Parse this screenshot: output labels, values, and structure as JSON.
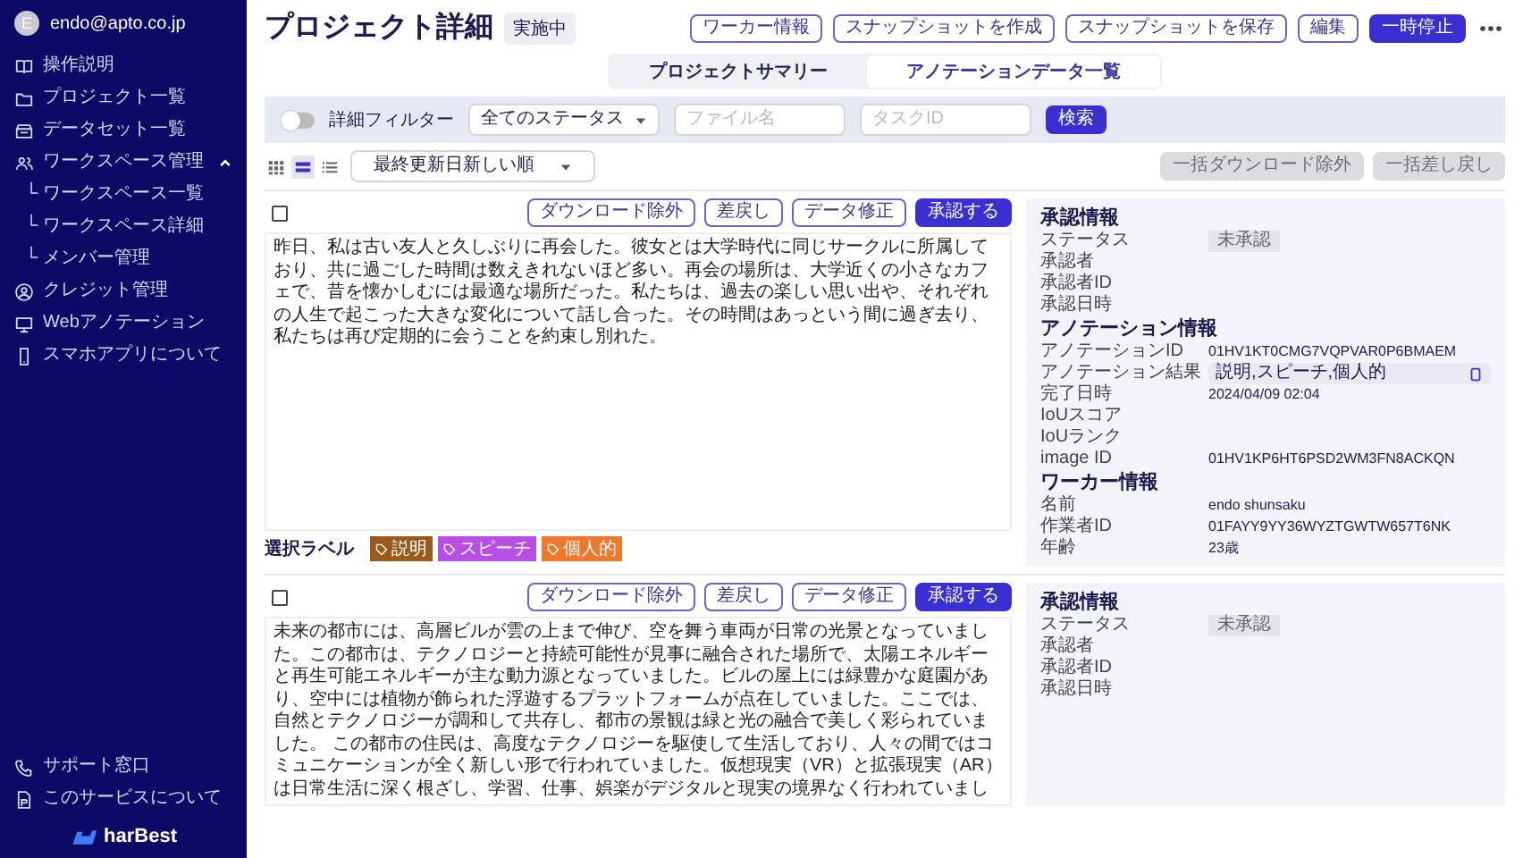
{
  "sidebar": {
    "user": {
      "initial": "E",
      "email": "endo@apto.co.jp"
    },
    "items": [
      {
        "label": "操作説明"
      },
      {
        "label": "プロジェクト一覧"
      },
      {
        "label": "データセット一覧"
      },
      {
        "label": "ワークスペース管理",
        "expanded": true,
        "children": [
          {
            "label": "└ ワークスペース一覧"
          },
          {
            "label": "└ ワークスペース詳細"
          },
          {
            "label": "└ メンバー管理"
          }
        ]
      },
      {
        "label": "クレジット管理"
      },
      {
        "label": "Webアノテーション"
      },
      {
        "label": "スマホアプリについて"
      }
    ],
    "footer_items": [
      {
        "label": "サポート窓口"
      },
      {
        "label": "このサービスについて"
      }
    ],
    "logo": "harBest"
  },
  "header": {
    "title": "プロジェクト詳細",
    "status_badge": "実施中",
    "buttons": [
      {
        "label": "ワーカー情報",
        "primary": false
      },
      {
        "label": "スナップショットを作成",
        "primary": false
      },
      {
        "label": "スナップショットを保存",
        "primary": false
      },
      {
        "label": "編集",
        "primary": false
      },
      {
        "label": "一時停止",
        "primary": true
      }
    ]
  },
  "tabs": [
    {
      "label": "プロジェクトサマリー",
      "selected": false
    },
    {
      "label": "アノテーションデータ一覧",
      "selected": true
    }
  ],
  "filter": {
    "toggle_label": "詳細フィルター",
    "on": false,
    "status_select": "全てのステータス",
    "file_field": {
      "placeholder": "ファイル名"
    },
    "task_field": {
      "placeholder": "タスクID"
    },
    "search_button": "検索"
  },
  "toolbar": {
    "views": [
      {
        "selected": false
      },
      {
        "selected": true
      },
      {
        "selected": false
      }
    ],
    "sort_select": "最終更新日新しい順",
    "bulk_buttons": [
      {
        "label": "一括ダウンロード除外",
        "disabled": true
      },
      {
        "label": "一括差し戻し",
        "disabled": true
      }
    ]
  },
  "records": [
    {
      "checked": false,
      "actions": [
        {
          "label": "ダウンロード除外",
          "primary": false
        },
        {
          "label": "差戻し",
          "primary": false
        },
        {
          "label": "データ修正",
          "primary": false
        },
        {
          "label": "承認する",
          "primary": true
        }
      ],
      "text": "昨日、私は古い友人と久しぶりに再会した。彼女とは大学時代に同じサークルに所属しており、共に過ごした時間は数えきれないほど多い。再会の場所は、大学近くの小さなカフェで、昔を懐かしむには最適な場所だった。私たちは、過去の楽しい思い出や、それぞれの人生で起こった大きな変化について話し合った。その時間はあっという間に過ぎ去り、私たちは再び定期的に会うことを約束し別れた。",
      "labels_title": "選択ラベル",
      "labels": [
        {
          "text": "説明",
          "color": "#9a5a1c"
        },
        {
          "text": "スピーチ",
          "color": "#b84ee6"
        },
        {
          "text": "個人的",
          "color": "#f0782c"
        }
      ],
      "info": [
        {
          "heading": "承認情報",
          "rows": [
            {
              "label": "ステータス",
              "value": "未承認",
              "kind": "badge"
            },
            {
              "label": "承認者"
            },
            {
              "label": "承認者ID"
            },
            {
              "label": "承認日時"
            }
          ]
        },
        {
          "heading": "アノテーション情報",
          "rows": [
            {
              "label": "アノテーションID",
              "value": "01HV1KT0CMG7VQPVAR0P6BMAEM",
              "kind": "text"
            },
            {
              "label": "アノテーション結果",
              "value": "説明,スピーチ,個人的",
              "kind": "copy"
            },
            {
              "label": "完了日時",
              "value": "2024/04/09 02:04",
              "kind": "text"
            },
            {
              "label": "IoUスコア"
            },
            {
              "label": "IoUランク"
            },
            {
              "label": "image ID",
              "value": "01HV1KP6HT6PSD2WM3FN8ACKQN",
              "kind": "text"
            }
          ]
        },
        {
          "heading": "ワーカー情報",
          "rows": [
            {
              "label": "名前",
              "value": "endo shunsaku",
              "kind": "text"
            },
            {
              "label": "作業者ID",
              "value": "01FAYY9YY36WYZTGWTW657T6NK",
              "kind": "text"
            },
            {
              "label": "年齢",
              "value": "23歳",
              "kind": "text"
            }
          ]
        }
      ]
    },
    {
      "checked": false,
      "actions": [
        {
          "label": "ダウンロード除外",
          "primary": false
        },
        {
          "label": "差戻し",
          "primary": false
        },
        {
          "label": "データ修正",
          "primary": false
        },
        {
          "label": "承認する",
          "primary": true
        }
      ],
      "text": "未来の都市には、高層ビルが雲の上まで伸び、空を舞う車両が日常の光景となっていました。この都市は、テクノロジーと持続可能性が見事に融合された場所で、太陽エネルギーと再生可能エネルギーが主な動力源となっていました。ビルの屋上には緑豊かな庭園があり、空中には植物が飾られた浮遊するプラットフォームが点在していました。ここでは、自然とテクノロジーが調和して共存し、都市の景観は緑と光の融合で美しく彩られていました。 この都市の住民は、高度なテクノロジーを駆使して生活しており、人々の間ではコミュニケーションが全く新しい形で行われていました。仮想現実（VR）と拡張現実（AR）は日常生活に深く根ざし、学習、仕事、娯楽がデジタルと現実の境界なく行われていまし",
      "info": [
        {
          "heading": "承認情報",
          "rows": [
            {
              "label": "ステータス",
              "value": "未承認",
              "kind": "badge"
            },
            {
              "label": "承認者"
            },
            {
              "label": "承認者ID"
            },
            {
              "label": "承認日時"
            }
          ]
        }
      ]
    }
  ]
}
